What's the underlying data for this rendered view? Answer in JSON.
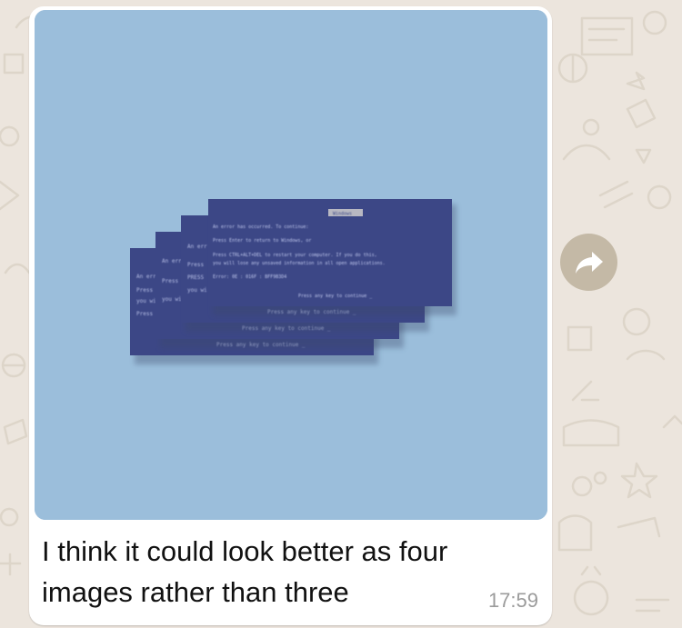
{
  "conversation": {
    "wallpaper": "doodle-pattern",
    "background_color": "#ece5dd"
  },
  "message": {
    "direction": "incoming",
    "bubble_color": "#ffffff",
    "image": {
      "description_icon": "stacked-error-screens-image",
      "background_color": "#9bbedb",
      "screen_color": "#3c4786",
      "title_badge_text": "Windows",
      "screens": [
        {
          "title": "",
          "lines": [
            "Press any key to continue _"
          ]
        },
        {
          "title": "",
          "lines": [
            "Press any key to continue _"
          ]
        },
        {
          "title": "",
          "lines": [
            "Press any key to continue _"
          ]
        },
        {
          "title": "Windows",
          "lines": [
            "An error has occurred. To continue:",
            "Press Enter to return to Windows, or",
            "Press CTRL+ALT+DEL to restart your computer. If you do this,",
            "you will lose any unsaved information in all open applications.",
            "Error: 0E : 016F : BFF9B3D4",
            "Press any key to continue _"
          ]
        }
      ]
    },
    "caption": "I think it could look better as four images rather than three",
    "time": "17:59"
  },
  "actions": {
    "forward_icon": "forward-arrow-icon",
    "forward_button_color": "#c4b9a6"
  }
}
